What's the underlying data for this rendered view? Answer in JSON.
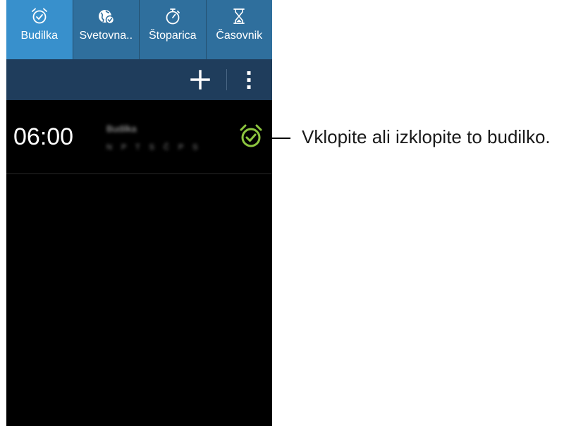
{
  "tabs": [
    {
      "label": "Budilka",
      "icon": "alarm-clock-icon",
      "active": true
    },
    {
      "label": "Svetovna..",
      "icon": "world-clock-icon",
      "active": false
    },
    {
      "label": "Štoparica",
      "icon": "stopwatch-icon",
      "active": false
    },
    {
      "label": "Časovnik",
      "icon": "hourglass-icon",
      "active": false
    }
  ],
  "actionbar": {
    "add_icon": "plus-icon",
    "menu_icon": "more-options-icon"
  },
  "alarm": {
    "time": "06:00",
    "name": "Budilka",
    "days": "N P T S Č P S",
    "toggle_icon": "alarm-on-icon",
    "toggle_color": "#8dc63f"
  },
  "callout": {
    "text": "Vklopite ali izklopite to budilko."
  },
  "colors": {
    "tab_bar": "#2f6f9d",
    "tab_active": "#3890cc",
    "action_bar": "#1f3d5c",
    "screen_bg": "#000000"
  }
}
